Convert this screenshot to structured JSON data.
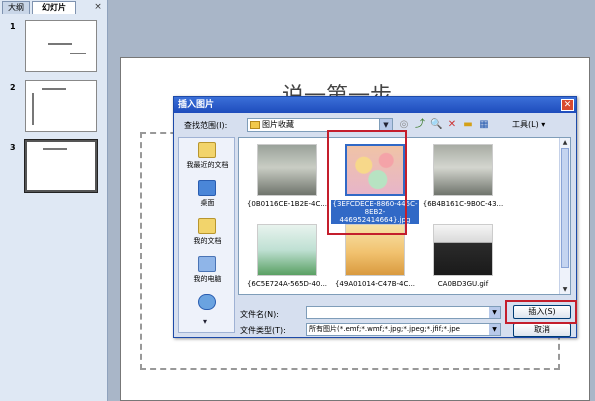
{
  "left_panel": {
    "tabs": [
      {
        "label": "大纲"
      },
      {
        "label": "幻灯片"
      }
    ],
    "close_glyph": "×",
    "slides": [
      {
        "number": "1"
      },
      {
        "number": "2"
      },
      {
        "number": "3"
      }
    ]
  },
  "slide": {
    "title": "说一第一步"
  },
  "dialog": {
    "title": "插入图片",
    "close_glyph": "✕",
    "look_in_label": "查找范围(I):",
    "look_in_value": "图片收藏",
    "tools_label": "工具(L)",
    "places": [
      {
        "label": "我最近的文档"
      },
      {
        "label": "桌面"
      },
      {
        "label": "我的文档"
      },
      {
        "label": "我的电脑"
      },
      {
        "label": ""
      }
    ],
    "files": [
      {
        "name": "{0B0116CE-1B2E-4C...",
        "selected": false
      },
      {
        "name": "{3EFCDECE-8860-445C-8EB2-446952414664}.jpg",
        "selected": true
      },
      {
        "name": "{6B4B161C-9B0C-43...",
        "selected": false
      },
      {
        "name": "{6C5E724A-565D-40...",
        "selected": false
      },
      {
        "name": "{49A01014-C47B-4C...",
        "selected": false
      },
      {
        "name": "CA0BD3GU.gif",
        "selected": false
      }
    ],
    "filename_label": "文件名(N):",
    "filename_value": "",
    "filetype_label": "文件类型(T):",
    "filetype_value": "所有图片(*.emf;*.wmf;*.jpg;*.jpeg;*.jfif;*.jpe",
    "insert_label": "插入(S)",
    "cancel_label": "取消"
  }
}
